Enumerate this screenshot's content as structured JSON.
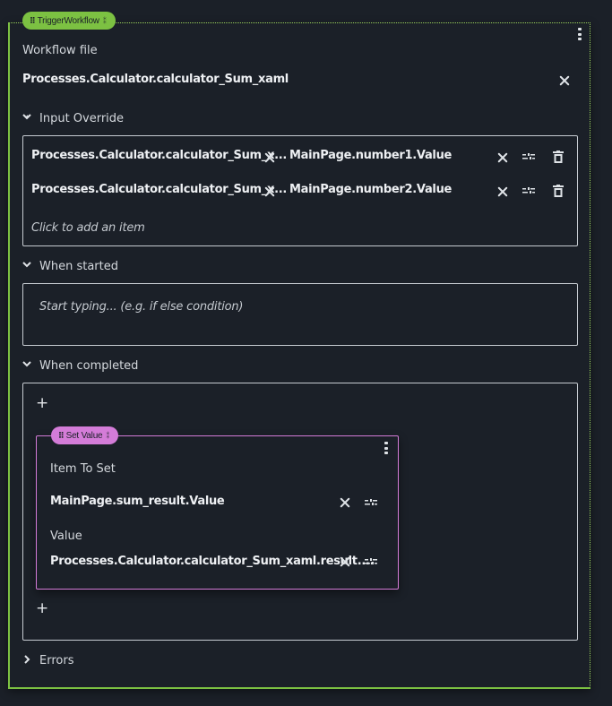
{
  "trigger_workflow": {
    "pill_label": "TriggerWorkflow",
    "workflow_file_label": "Workflow file",
    "workflow_file_value": "Processes.Calculator.calculator_Sum_xaml",
    "input_override": {
      "header": "Input Override",
      "items": [
        {
          "key": "Processes.Calculator.calculator_Sum_x...",
          "value": "MainPage.number1.Value"
        },
        {
          "key": "Processes.Calculator.calculator_Sum_x...",
          "value": "MainPage.number2.Value"
        }
      ],
      "add_item_label": "Click to add an item"
    },
    "when_started": {
      "header": "When started",
      "placeholder": "Start typing... (e.g. if else condition)"
    },
    "when_completed": {
      "header": "When completed",
      "add_symbol": "+",
      "set_value": {
        "pill_label": "Set Value",
        "item_to_set_label": "Item To Set",
        "item_to_set_value": "MainPage.sum_result.Value",
        "value_label": "Value",
        "value_value": "Processes.Calculator.calculator_Sum_xaml.result...."
      }
    },
    "errors": {
      "header": "Errors"
    }
  },
  "colors": {
    "trigger_accent": "#7cc142",
    "setvalue_accent": "#d47cd8",
    "background": "#1b2028"
  }
}
